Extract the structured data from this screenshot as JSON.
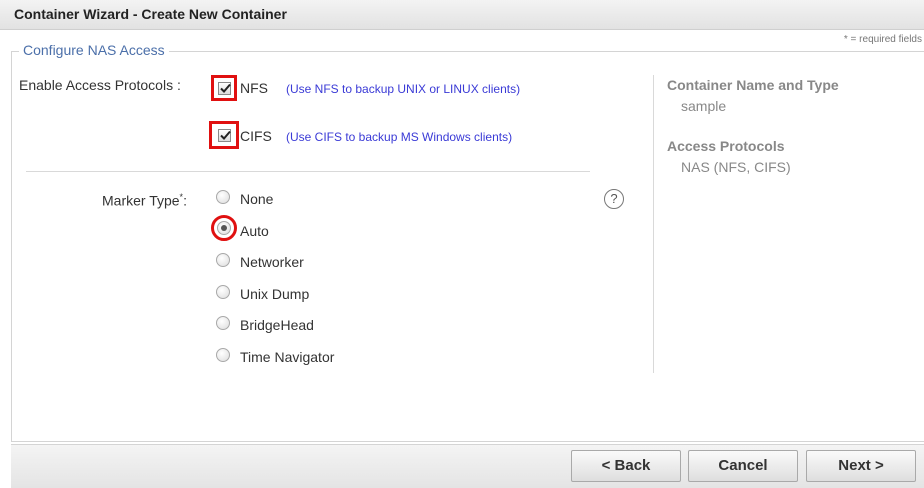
{
  "window": {
    "title": "Container Wizard - Create New Container"
  },
  "required_note": "* = required fields",
  "section": {
    "legend": "Configure NAS Access"
  },
  "protocols": {
    "label": "Enable Access Protocols :",
    "nfs": {
      "label": "NFS",
      "hint": "(Use NFS to backup UNIX or LINUX clients)",
      "checked": true
    },
    "cifs": {
      "label": "CIFS",
      "hint": "(Use CIFS to backup MS Windows clients)",
      "checked": true
    }
  },
  "marker": {
    "label": "Marker Type",
    "required_mark": "*",
    "colon": ":",
    "help_glyph": "?",
    "options": [
      {
        "label": "None",
        "selected": false
      },
      {
        "label": "Auto",
        "selected": true
      },
      {
        "label": "Networker",
        "selected": false
      },
      {
        "label": "Unix Dump",
        "selected": false
      },
      {
        "label": "BridgeHead",
        "selected": false
      },
      {
        "label": "Time Navigator",
        "selected": false
      }
    ]
  },
  "summary": {
    "name_type_heading": "Container Name and Type",
    "name_type_value": "sample",
    "protocols_heading": "Access Protocols",
    "protocols_value": "NAS (NFS, CIFS)"
  },
  "buttons": {
    "back": "< Back",
    "cancel": "Cancel",
    "next": "Next >"
  },
  "colors": {
    "highlight": "#e01010",
    "hint": "#3a3ad6",
    "legend": "#4b6fa9"
  }
}
